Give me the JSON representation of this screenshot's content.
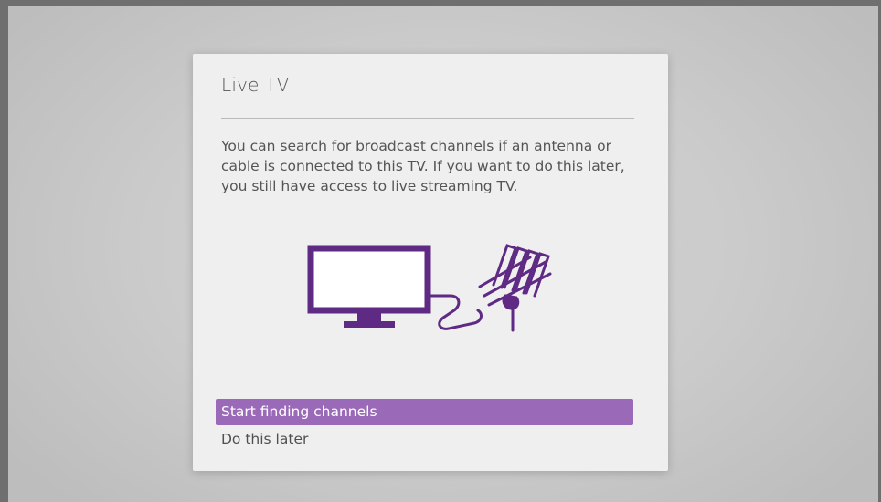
{
  "dialog": {
    "title": "Live TV",
    "description": "You can search for broadcast channels if an antenna or cable is connected to this TV. If you want to do this later, you still have access to live streaming TV.",
    "illustration": {
      "icons": [
        "tv-icon",
        "cable-icon",
        "antenna-icon"
      ],
      "color": "#5f2a84"
    },
    "menu": [
      {
        "label": "Start finding channels",
        "selected": true
      },
      {
        "label": "Do this later",
        "selected": false
      }
    ]
  },
  "colors": {
    "accent": "#9a6ab9",
    "illustration": "#5f2a84",
    "dialog_background": "#efefef",
    "screen_background": "#cbcbcb"
  }
}
